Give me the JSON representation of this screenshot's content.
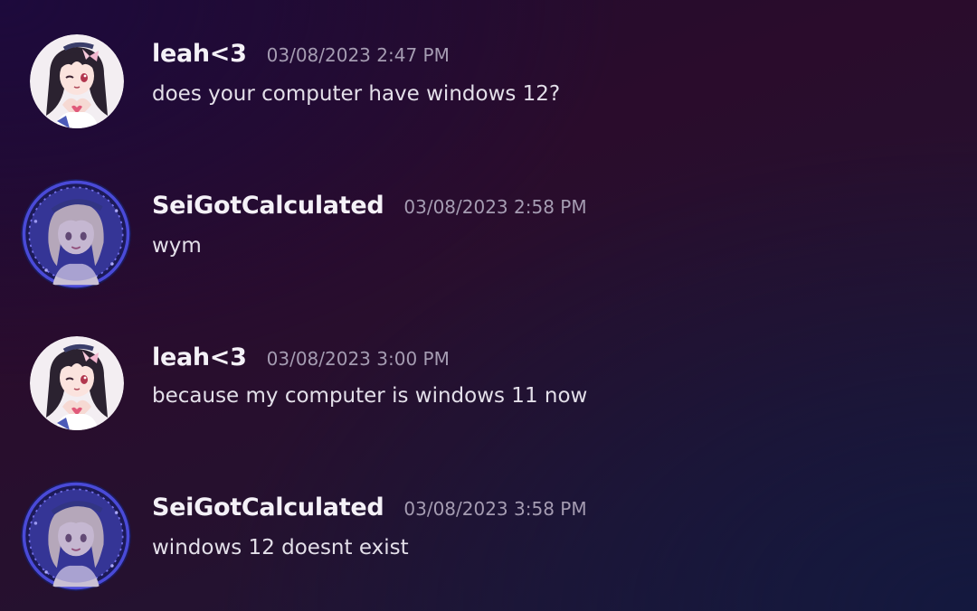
{
  "messages": [
    {
      "author": "leah<3",
      "timestamp": "03/08/2023 2:47 PM",
      "content": "does your computer have windows 12?",
      "avatar": "leah-avatar"
    },
    {
      "author": "SeiGotCalculated",
      "timestamp": "03/08/2023 2:58 PM",
      "content": "wym",
      "avatar": "sei-avatar"
    },
    {
      "author": "leah<3",
      "timestamp": "03/08/2023 3:00 PM",
      "content": "because my computer is windows 11 now",
      "avatar": "leah-avatar"
    },
    {
      "author": "SeiGotCalculated",
      "timestamp": "03/08/2023 3:58 PM",
      "content": "windows 12 doesnt exist",
      "avatar": "sei-avatar"
    }
  ],
  "colors": {
    "username": "#f4f1f7",
    "timestamp": "#a59cb2",
    "content": "#e3dfe9",
    "sei_avatar_ring": "#4a4ad8"
  }
}
